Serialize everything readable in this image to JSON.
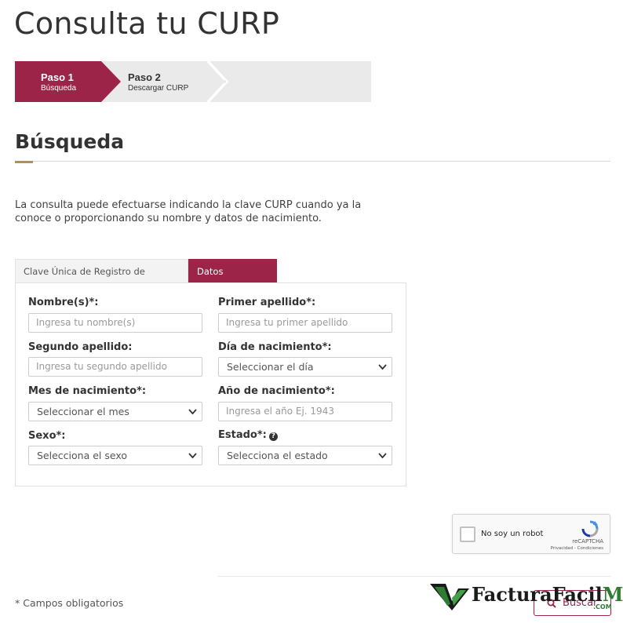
{
  "page": {
    "title": "Consulta tu CURP"
  },
  "stepper": {
    "steps": [
      {
        "number": "Paso 1",
        "label": "Búsqueda",
        "active": true
      },
      {
        "number": "Paso 2",
        "label": "Descargar CURP",
        "active": false
      }
    ]
  },
  "section": {
    "title": "Búsqueda",
    "intro": "La consulta puede efectuarse indicando la clave CURP cuando ya la conoce o proporcionando su nombre y datos de nacimiento."
  },
  "tabs": [
    {
      "label": "Clave Única de Registro de Población",
      "active": false
    },
    {
      "label": "Datos Personales",
      "active": true
    }
  ],
  "form": {
    "nombre": {
      "label": "Nombre(s)*:",
      "placeholder": "Ingresa tu nombre(s)"
    },
    "primer_apellido": {
      "label": "Primer apellido*:",
      "placeholder": "Ingresa tu primer apellido"
    },
    "segundo_apellido": {
      "label": "Segundo apellido:",
      "placeholder": "Ingresa tu segundo apellido"
    },
    "dia": {
      "label": "Día de nacimiento*:",
      "selected": "Seleccionar el día"
    },
    "mes": {
      "label": "Mes de nacimiento*:",
      "selected": "Seleccionar el mes"
    },
    "anio": {
      "label": "Año de nacimiento*:",
      "placeholder": "Ingresa el año Ej. 1943"
    },
    "sexo": {
      "label": "Sexo*:",
      "selected": "Selecciona el sexo"
    },
    "estado": {
      "label": "Estado*:",
      "selected": "Selecciona el estado"
    }
  },
  "recaptcha": {
    "label": "No soy un robot",
    "brand": "reCAPTCHA",
    "links": "Privacidad - Condiciones"
  },
  "footer": {
    "required_note": "* Campos obligatorios",
    "search_button": "Buscar"
  },
  "watermark": {
    "text_main": "FacturaFacil",
    "text_mx": "MX",
    "text_com": ".COM"
  },
  "colors": {
    "primary": "#9d2449",
    "accent": "#b38e5d",
    "stepper_bg": "#eaeaea"
  },
  "icons": {
    "help": "question-circle-icon",
    "search": "search-icon",
    "select": "chevron-down-icon"
  }
}
